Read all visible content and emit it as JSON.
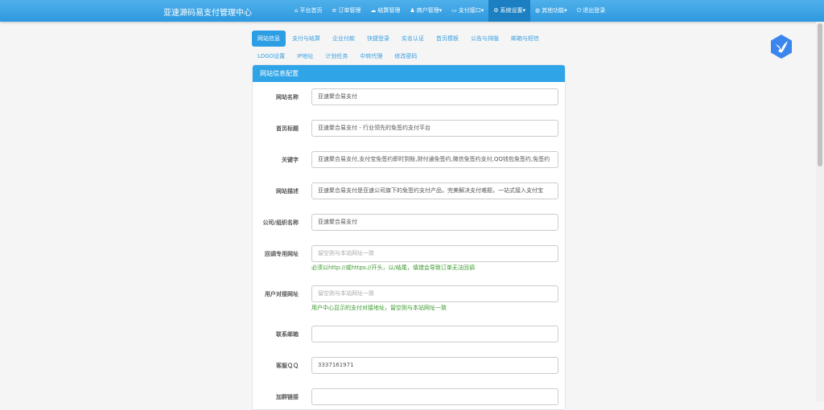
{
  "brand": "亚速源码易支付管理中心",
  "nav": [
    {
      "icon": "⌂",
      "label": "平台首页"
    },
    {
      "icon": "≡",
      "label": "订单管理"
    },
    {
      "icon": "☁",
      "label": "结算管理"
    },
    {
      "icon": "♟",
      "label": "商户管理▾"
    },
    {
      "icon": "▭",
      "label": "支付接口▾"
    },
    {
      "icon": "⚙",
      "label": "系统设置▾"
    },
    {
      "icon": "◍",
      "label": "其他功能▾"
    },
    {
      "icon": "⏻",
      "label": "退出登录"
    }
  ],
  "tabs": [
    "网站信息",
    "支付与结算",
    "企业付款",
    "快捷登录",
    "实名认证",
    "首页模板",
    "公告与排版",
    "邮箱与短信",
    "LOGO设置",
    "IP地址",
    "计划任务",
    "中转代理",
    "修改密码"
  ],
  "panel_title": "网站信息配置",
  "fields": [
    {
      "label": "网站名称",
      "value": "亚速聚合易支付",
      "placeholder": "",
      "hint": ""
    },
    {
      "label": "首页标题",
      "value": "亚速聚合易支付 - 行业领先的免签约支付平台",
      "placeholder": "",
      "hint": ""
    },
    {
      "label": "关键字",
      "value": "亚速聚合易支付,支付宝免签约即时到账,财付通免签约,微信免签约支付,QQ钱包免签约,免签约",
      "placeholder": "",
      "hint": ""
    },
    {
      "label": "网站描述",
      "value": "亚速聚合易支付是亚速公司旗下的免签约支付产品，完美解决支付难题，一站式接入支付宝",
      "placeholder": "",
      "hint": ""
    },
    {
      "label": "公司/组织名称",
      "value": "亚速聚合易支付",
      "placeholder": "",
      "hint": ""
    },
    {
      "label": "回调专用网址",
      "value": "",
      "placeholder": "留空则与本站网址一致",
      "hint": "必须以http://或https://开头，以/结尾，填错会导致订单无法回调"
    },
    {
      "label": "用户对接网址",
      "value": "",
      "placeholder": "留空则与本站网址一致",
      "hint": "用户中心显示的支付对接地址，留空则与本站网址一致"
    },
    {
      "label": "联系邮箱",
      "value": "",
      "placeholder": "",
      "hint": ""
    },
    {
      "label": "客服ＱＱ",
      "value": "3337161971",
      "placeholder": "",
      "hint": ""
    },
    {
      "label": "加群链接",
      "value": "",
      "placeholder": "",
      "hint": ""
    }
  ]
}
